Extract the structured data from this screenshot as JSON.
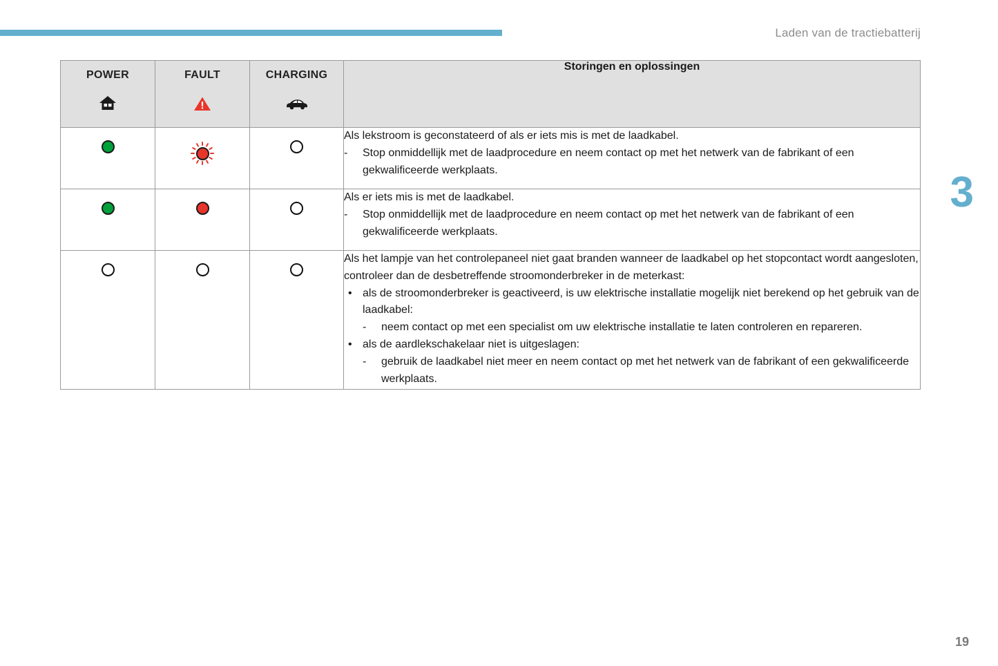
{
  "header": {
    "title": "Laden van de tractiebatterij",
    "accent_color": "#63afcd"
  },
  "chapter": {
    "number": "3"
  },
  "page": {
    "number": "19"
  },
  "table": {
    "columns": [
      {
        "label": "POWER",
        "icon": "house-icon"
      },
      {
        "label": "FAULT",
        "icon": "warning-triangle-icon"
      },
      {
        "label": "CHARGING",
        "icon": "car-icon"
      }
    ],
    "description_header": "Storingen en oplossingen",
    "rows": [
      {
        "indicators": [
          "green-on",
          "red-blinking",
          "off"
        ],
        "lines": [
          {
            "level": 0,
            "marker": "",
            "text": "Als lekstroom is geconstateerd of als er iets mis is met de laadkabel."
          },
          {
            "level": 1,
            "marker": "-",
            "text": "Stop onmiddellijk met de laadprocedure en neem contact op met het netwerk van de fabrikant of een gekwalificeerde werkplaats."
          }
        ]
      },
      {
        "indicators": [
          "green-on",
          "red-on",
          "off"
        ],
        "lines": [
          {
            "level": 0,
            "marker": "",
            "text": "Als er iets mis is met de laadkabel."
          },
          {
            "level": 1,
            "marker": "-",
            "text": "Stop onmiddellijk met de laadprocedure en neem contact op met het netwerk van de fabrikant of een gekwalificeerde werkplaats."
          }
        ]
      },
      {
        "indicators": [
          "off",
          "off",
          "off"
        ],
        "lines": [
          {
            "level": 0,
            "marker": "",
            "text": "Als het lampje van het controlepaneel niet gaat branden wanneer de laadkabel op het stopcontact wordt aangesloten, controleer dan de desbetreffende stroomonderbreker in de meterkast:"
          },
          {
            "level": 1,
            "marker": "•",
            "text": "als de stroomonderbreker is geactiveerd, is uw elektrische installatie mogelijk niet berekend op het gebruik van de laadkabel:"
          },
          {
            "level": 2,
            "marker": "-",
            "text": "neem contact op met een specialist om uw elektrische installatie te laten controleren en repareren."
          },
          {
            "level": 1,
            "marker": "•",
            "text": "als de aardlekschakelaar niet is uitgeslagen:"
          },
          {
            "level": 2,
            "marker": "-",
            "text": "gebruik de laadkabel niet meer en neem contact op met het netwerk van de fabrikant of een gekwalificeerde werkplaats."
          }
        ]
      }
    ]
  },
  "colors": {
    "lamp_green": "#00a13a",
    "lamp_red": "#e8352b",
    "warning_red": "#e8352b",
    "header_fill": "#e0e0e0",
    "border": "#9a9a9a"
  }
}
